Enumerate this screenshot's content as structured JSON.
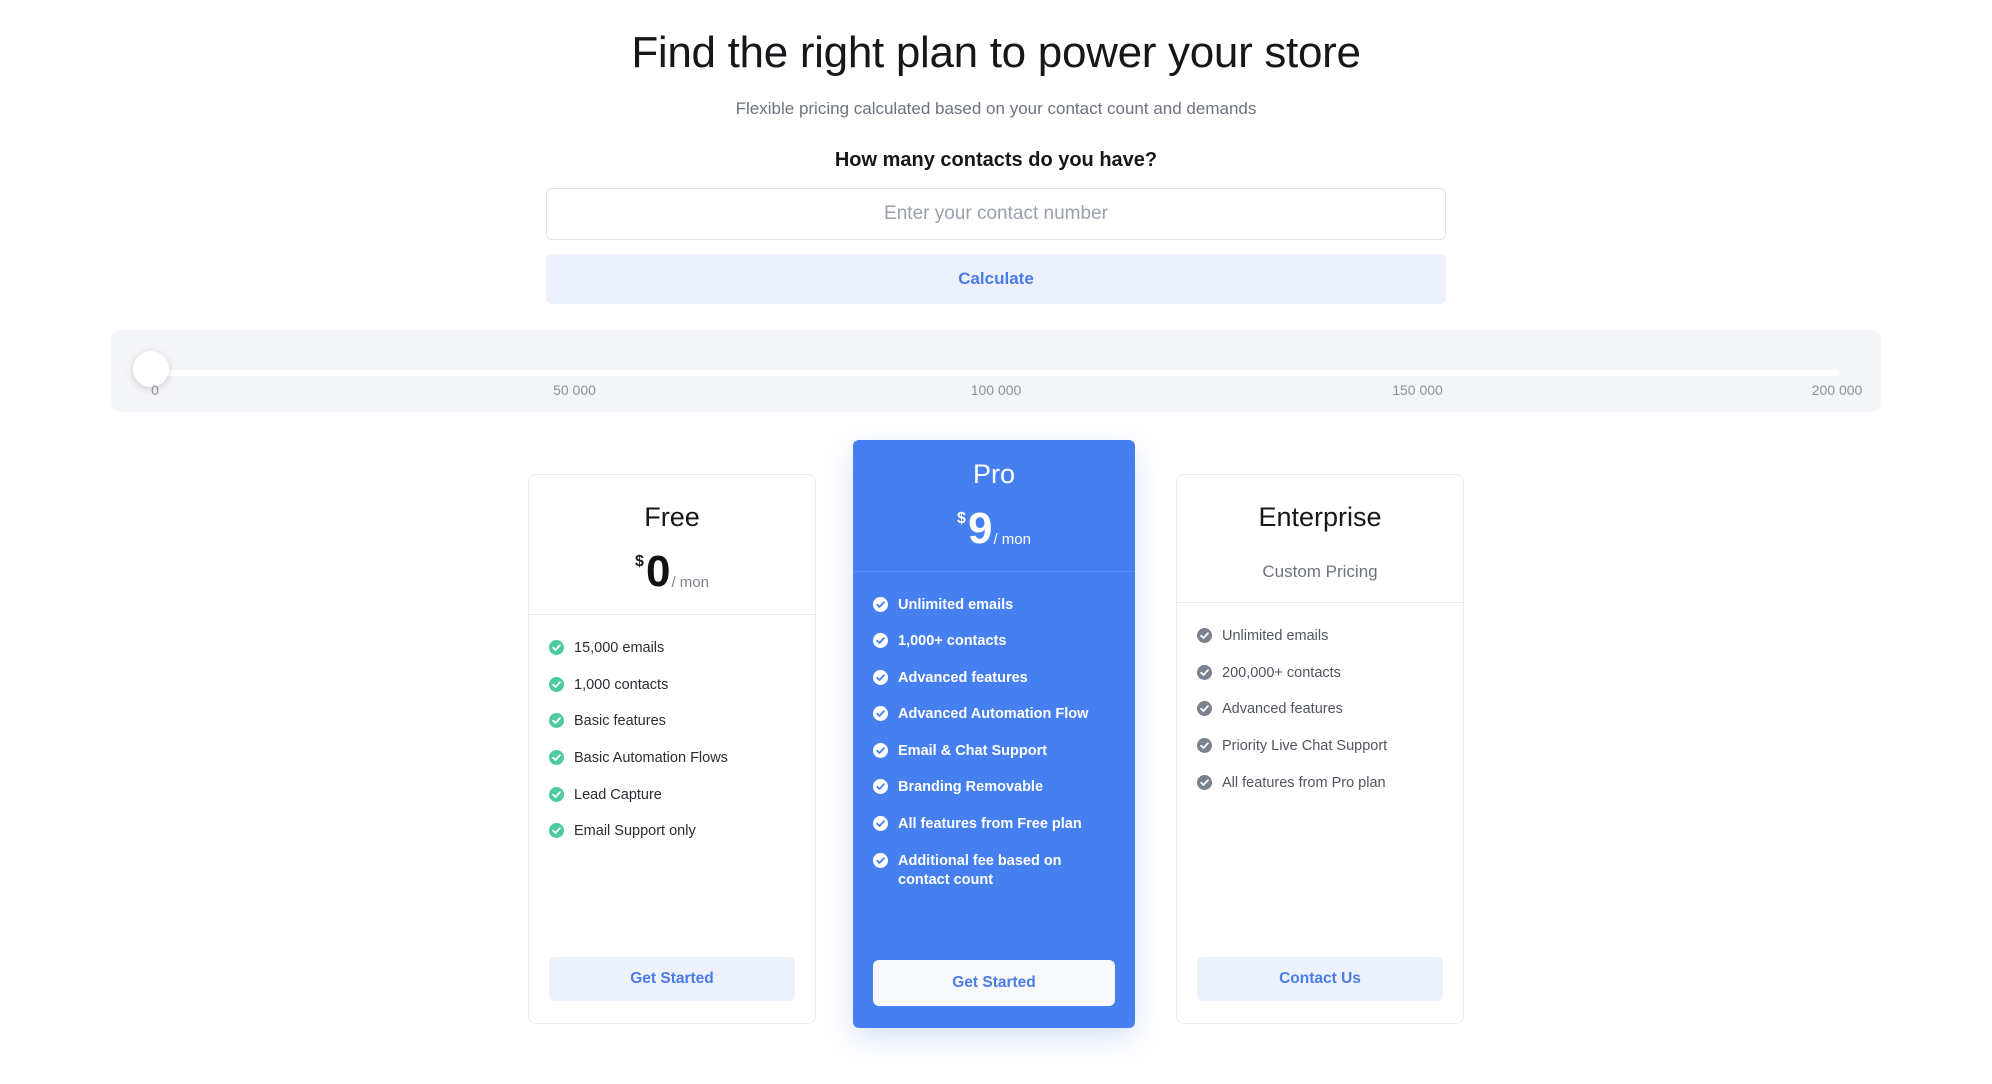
{
  "header": {
    "title": "Find the right plan to power your store",
    "subtitle": "Flexible pricing calculated based on your contact count and demands"
  },
  "calculator": {
    "label": "How many contacts do you have?",
    "input_placeholder": "Enter your contact number",
    "input_value": "",
    "button_label": "Calculate"
  },
  "slider": {
    "value": 0,
    "min": 0,
    "max": 200000,
    "ticks": [
      {
        "label": "0",
        "pos": 0
      },
      {
        "label": "50 000",
        "pos": 25
      },
      {
        "label": "100 000",
        "pos": 50
      },
      {
        "label": "150 000",
        "pos": 75
      },
      {
        "label": "200 000",
        "pos": 100
      }
    ]
  },
  "colors": {
    "accent_blue": "#4680f0",
    "button_blue_text": "#4a7ce8",
    "button_blue_bg": "#edf1fd",
    "check_green": "#4dcb9c",
    "check_gray": "#7a828e",
    "panel_gray": "#f4f5f8"
  },
  "plans": [
    {
      "id": "free",
      "name": "Free",
      "currency": "$",
      "amount": "0",
      "period": "/ mon",
      "custom_price": "",
      "check_icon": "check-circle-icon",
      "features": [
        "15,000 emails",
        "1,000 contacts",
        "Basic features",
        "Basic Automation Flows",
        "Lead Capture",
        "Email Support only"
      ],
      "cta_label": "Get Started"
    },
    {
      "id": "pro",
      "name": "Pro",
      "currency": "$",
      "amount": "9",
      "period": "/ mon",
      "custom_price": "",
      "check_icon": "check-circle-icon",
      "features": [
        "Unlimited emails",
        "1,000+ contacts",
        "Advanced features",
        "Advanced Automation Flow",
        "Email & Chat Support",
        "Branding Removable",
        "All features from Free plan",
        "Additional fee based on contact count"
      ],
      "cta_label": "Get Started"
    },
    {
      "id": "enterprise",
      "name": "Enterprise",
      "currency": "",
      "amount": "",
      "period": "",
      "custom_price": "Custom Pricing",
      "check_icon": "check-circle-icon",
      "features": [
        "Unlimited emails",
        "200,000+ contacts",
        "Advanced features",
        "Priority Live Chat Support",
        "All features from Pro plan"
      ],
      "cta_label": "Contact Us"
    }
  ]
}
